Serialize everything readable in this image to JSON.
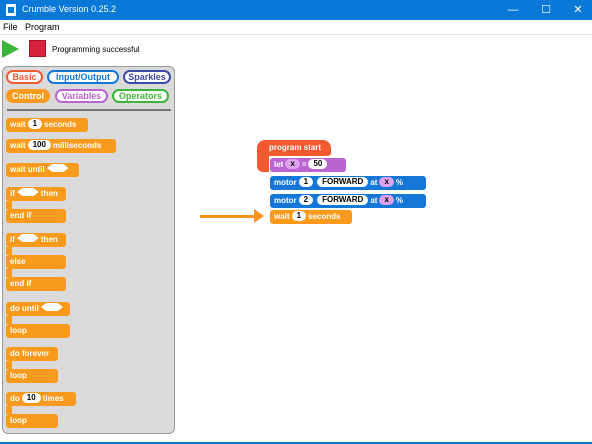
{
  "window": {
    "title": "Crumble Version 0.25.2",
    "minimize": "—",
    "maximize": "☐",
    "close": "✕"
  },
  "menu": {
    "file": "File",
    "program": "Program"
  },
  "toolbar": {
    "status": "Programming successful"
  },
  "palette": {
    "tabs": {
      "basic": "Basic",
      "input_output": "Input/Output",
      "sparkles": "Sparkles",
      "control": "Control",
      "variables": "Variables",
      "operators": "Operators"
    },
    "blocks": {
      "wait_seconds": {
        "prefix": "wait",
        "value": "1",
        "suffix": "seconds"
      },
      "wait_ms": {
        "prefix": "wait",
        "value": "100",
        "suffix": "milliseconds"
      },
      "wait_until": {
        "prefix": "wait until"
      },
      "if_then": {
        "prefix": "if",
        "suffix": "then",
        "end": "end if"
      },
      "if_else": {
        "prefix": "if",
        "suffix": "then",
        "else": "else",
        "end": "end if"
      },
      "do_until": {
        "prefix": "do until",
        "end": "loop"
      },
      "do_forever": {
        "prefix": "do forever",
        "end": "loop"
      },
      "do_times": {
        "prefix": "do",
        "value": "10",
        "suffix": "times"
      }
    }
  },
  "program": {
    "start": "program start",
    "let": {
      "keyword": "let",
      "var": "x",
      "eq": "=",
      "value": "50"
    },
    "motor1": {
      "keyword": "motor",
      "num": "1",
      "dir": "FORWARD",
      "at": "at",
      "var": "x",
      "unit": "%"
    },
    "motor2": {
      "keyword": "motor",
      "num": "2",
      "dir": "FORWARD",
      "at": "at",
      "var": "x",
      "unit": "%"
    },
    "wait": {
      "prefix": "wait",
      "value": "1",
      "suffix": "seconds"
    }
  },
  "colors": {
    "titlebar": "#0a78d7",
    "control": "#f99a1c",
    "motor": "#1477d8",
    "variable": "#b964d2",
    "start": "#f3592f",
    "arrow": "#f7941d"
  }
}
